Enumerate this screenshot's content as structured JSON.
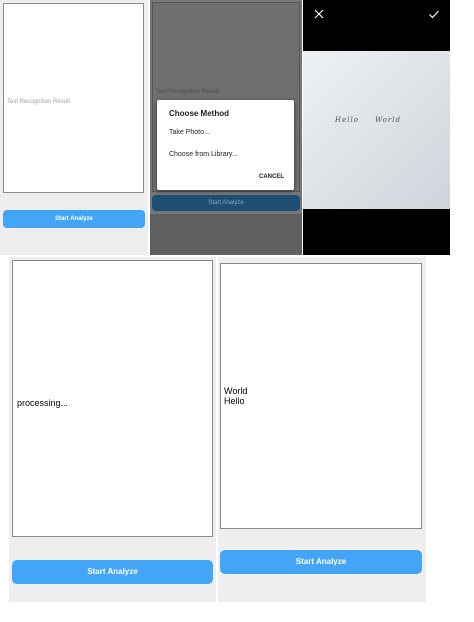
{
  "screens": {
    "initial": {
      "placeholder": "Text Recognition Result",
      "button_label": "Start Analyze"
    },
    "choose_dialog": {
      "placeholder": "Text Recognition Result",
      "button_label": "Start Analyze",
      "dialog_title": "Choose Method",
      "options": [
        "Take Photo...",
        "Choose from Library..."
      ],
      "cancel_label": "CANCEL"
    },
    "camera_crop": {
      "close_icon": "close-icon",
      "confirm_icon": "check-icon",
      "photo_words": [
        "Hello",
        "World"
      ]
    },
    "processing": {
      "status_text": "processing...",
      "button_label": "Start Analyze"
    },
    "result": {
      "lines": [
        "World",
        "Hello"
      ],
      "button_label": "Start Analyze"
    }
  },
  "colors": {
    "accent": "#42a5f5",
    "panel_bg": "#eeeeee",
    "dim_overlay": "#777777"
  }
}
